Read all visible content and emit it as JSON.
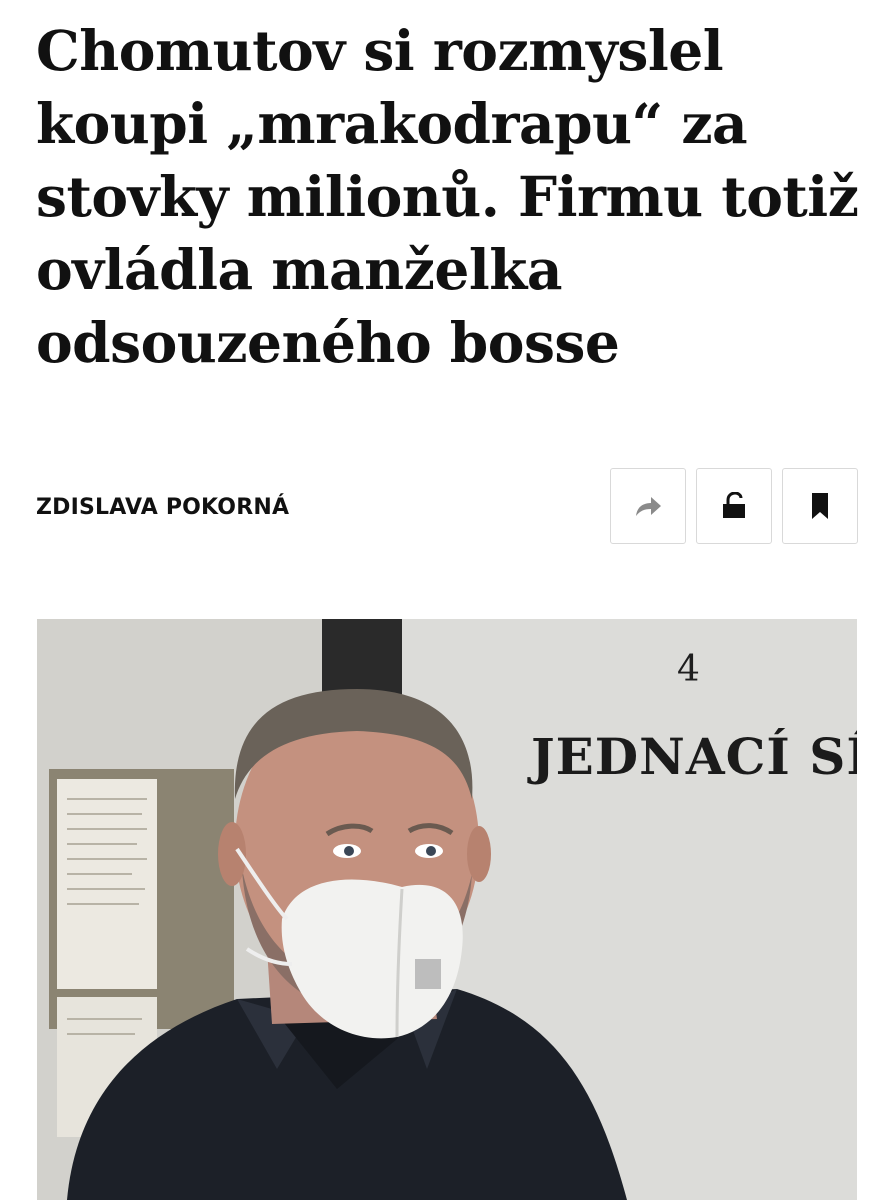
{
  "article": {
    "headline": "Chomutov si rozmyslel koupi „mrakodrapu“ za stovky milionů. Firmu totiž ovládla manželka odsouzeného bosse",
    "author": "ZDISLAVA POKORNÁ"
  },
  "actions": [
    {
      "icon": "share-icon",
      "color": "#8a8a8a"
    },
    {
      "icon": "unlock-icon",
      "color": "#111111"
    },
    {
      "icon": "bookmark-icon",
      "color": "#111111"
    }
  ],
  "photo": {
    "sign_number": "4",
    "sign_text": "JEDNACÍ SÍŇ"
  }
}
